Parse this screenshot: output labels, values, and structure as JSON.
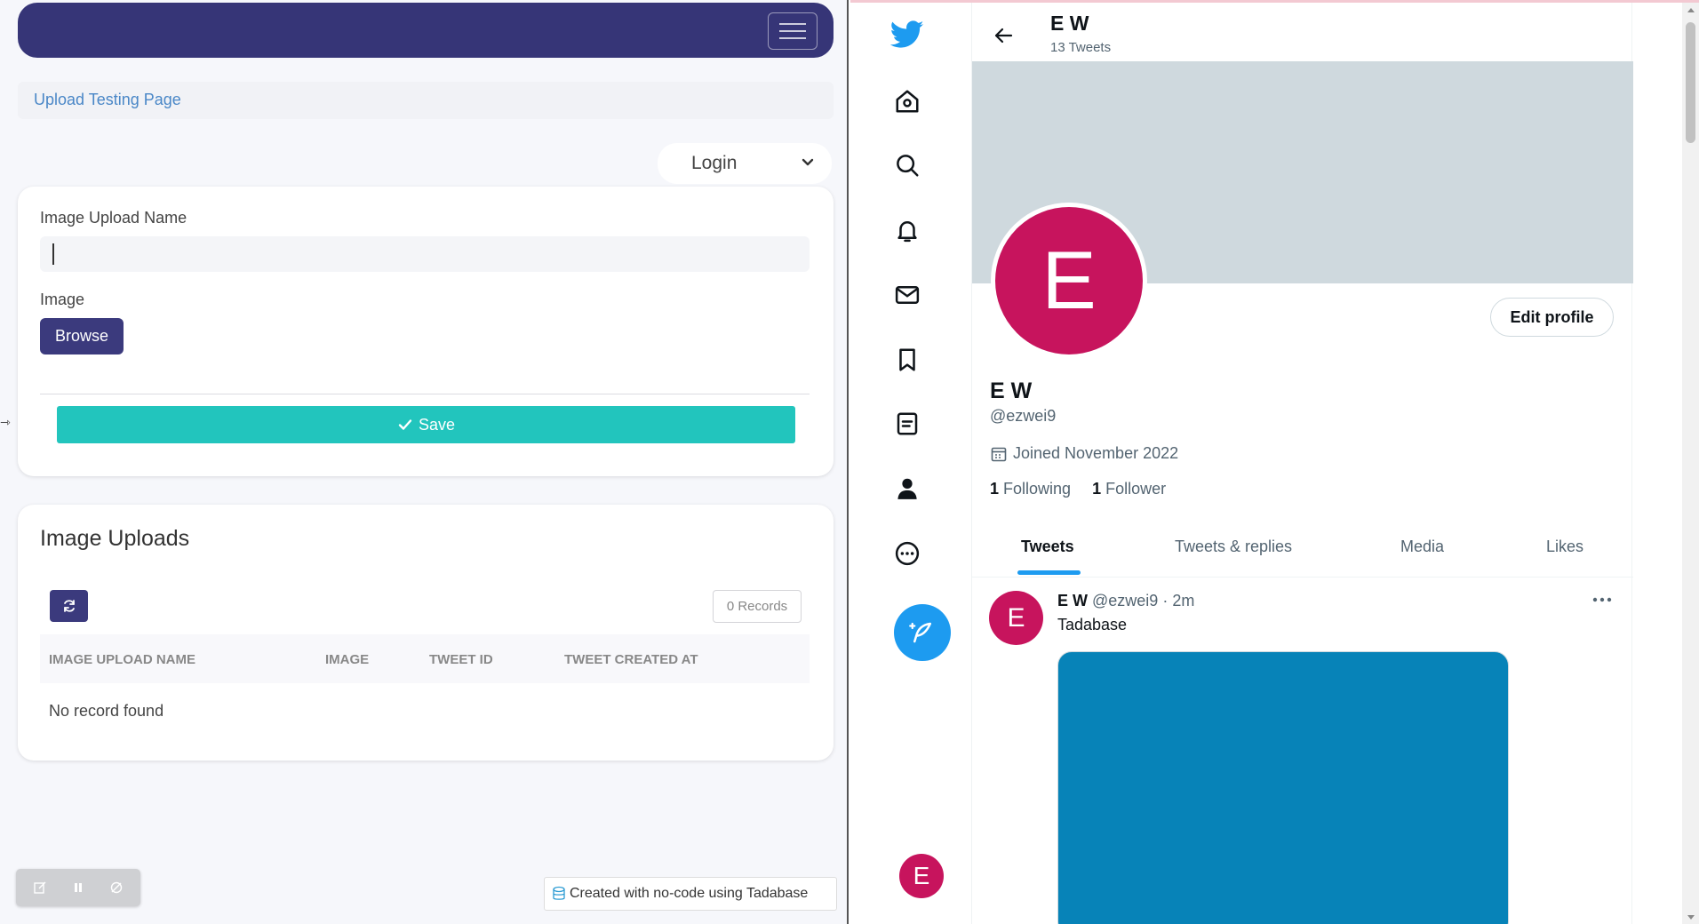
{
  "left_app": {
    "navbar": {
      "menu_icon": "hamburger-icon"
    },
    "breadcrumb": {
      "link_text": "Upload Testing Page"
    },
    "login_dropdown": {
      "selected": "Login",
      "icon": "chevron-down-icon"
    },
    "form": {
      "name_label": "Image Upload Name",
      "name_value": "",
      "image_label": "Image",
      "browse_label": "Browse",
      "save_label": "Save",
      "save_icon": "check-icon"
    },
    "uploads": {
      "title": "Image Uploads",
      "refresh_icon": "refresh-icon",
      "records_label": "0 Records",
      "columns": [
        "IMAGE UPLOAD NAME",
        "IMAGE",
        "TWEET ID",
        "TWEET CREATED AT"
      ],
      "empty_text": "No record found"
    },
    "toolbar": {
      "icons": [
        "edit-icon",
        "pause-icon",
        "settings-icon"
      ]
    },
    "footer_badge": "Created with no-code using Tadabase"
  },
  "right_app": {
    "rail": {
      "icons": [
        "twitter-logo-icon",
        "home-icon",
        "search-icon",
        "bell-icon",
        "mail-icon",
        "bookmark-icon",
        "list-icon",
        "profile-icon",
        "more-circle-icon"
      ],
      "compose_icon": "compose-feather-icon",
      "avatar_letter": "E"
    },
    "header": {
      "name": "E W",
      "tweet_count": "13 Tweets"
    },
    "profile": {
      "avatar_letter": "E",
      "edit_label": "Edit profile",
      "name": "E W",
      "handle": "@ezwei9",
      "joined": "Joined November 2022",
      "following_count": "1",
      "following_label": "Following",
      "followers_count": "1",
      "followers_label": "Follower"
    },
    "tabs": [
      "Tweets",
      "Tweets & replies",
      "Media",
      "Likes"
    ],
    "active_tab": "Tweets",
    "tweet": {
      "avatar_letter": "E",
      "name": "E W",
      "handle_time": "@ezwei9 · 2m",
      "text": "Tadabase"
    },
    "colors": {
      "twitter_blue": "#1d9bf0",
      "avatar_pink": "#c7145d",
      "banner_gray": "#cfd9de",
      "media_blue": "#0783b8"
    }
  },
  "left_colors": {
    "navbar": "#363577",
    "primary_button": "#3b3a7d",
    "save_button": "#22c5bd",
    "link": "#4a87c7"
  }
}
